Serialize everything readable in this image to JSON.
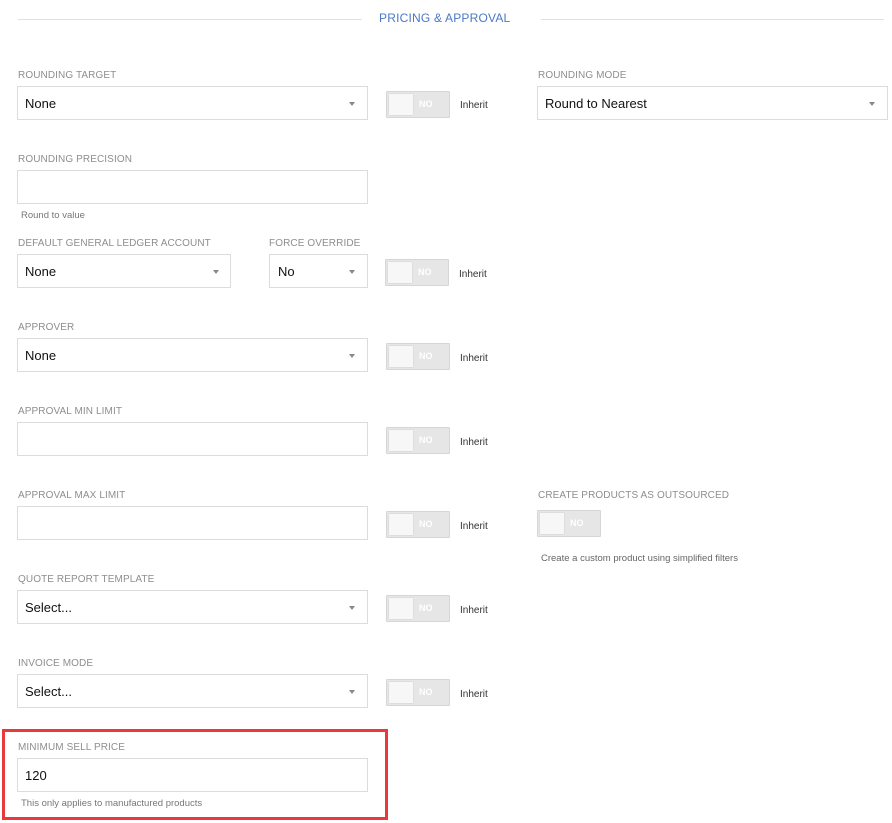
{
  "section": {
    "title": "PRICING & APPROVAL"
  },
  "rounding_target": {
    "label": "ROUNDING TARGET",
    "value": "None"
  },
  "rounding_mode": {
    "label": "ROUNDING MODE",
    "value": "Round to Nearest"
  },
  "rounding_precision": {
    "label": "ROUNDING PRECISION",
    "value": "",
    "hint": "Round to value"
  },
  "gl_account": {
    "label": "DEFAULT GENERAL LEDGER ACCOUNT",
    "value": "None"
  },
  "force_override": {
    "label": "FORCE OVERRIDE",
    "value": "No"
  },
  "approver": {
    "label": "APPROVER",
    "value": "None"
  },
  "approval_min": {
    "label": "APPROVAL MIN LIMIT",
    "value": ""
  },
  "approval_max": {
    "label": "APPROVAL MAX LIMIT",
    "value": ""
  },
  "outsourced": {
    "label": "CREATE PRODUCTS AS OUTSOURCED",
    "hint": "Create a custom product using simplified filters"
  },
  "quote_template": {
    "label": "QUOTE REPORT TEMPLATE",
    "value": "Select..."
  },
  "invoice_mode": {
    "label": "INVOICE MODE",
    "value": "Select..."
  },
  "min_sell_price": {
    "label": "MINIMUM SELL PRICE",
    "value": "120",
    "hint": "This only applies to manufactured products"
  },
  "toggle": {
    "off_label": "NO",
    "inherit_label": "Inherit"
  },
  "colors": {
    "accent": "#4a78c8",
    "highlight": "#e8393c"
  }
}
